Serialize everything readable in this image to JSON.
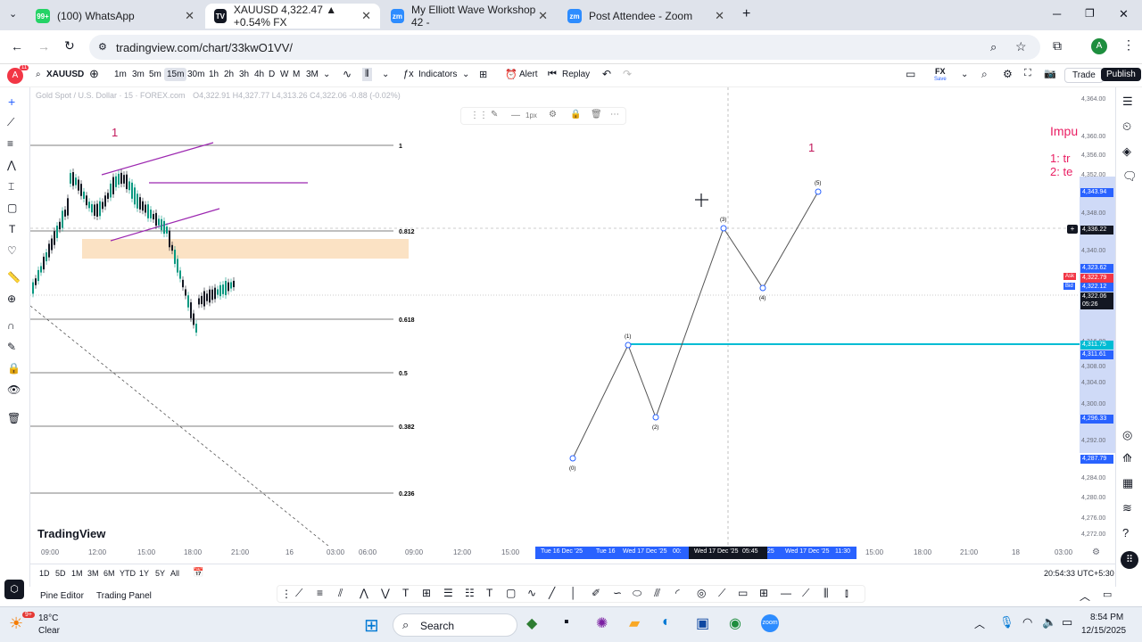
{
  "browser": {
    "tabs": [
      {
        "label": "(100) WhatsApp",
        "icon": "whatsapp-icon",
        "badge": "99+"
      },
      {
        "label": "XAUUSD 4,322.47 ▲ +0.54% FX",
        "icon": "tradingview-icon"
      },
      {
        "label": "My Elliott Wave Workshop 42 -",
        "icon": "zoom-icon"
      },
      {
        "label": "Post Attendee - Zoom",
        "icon": "zoom-icon"
      }
    ],
    "url": "tradingview.com/chart/33kwO1VV/",
    "profile_letter": "A"
  },
  "toolbar": {
    "avatar_letter": "A",
    "avatar_badge": "11",
    "symbol": "XAUUSD",
    "intervals": [
      "1m",
      "3m",
      "5m",
      "15m",
      "30m",
      "1h",
      "2h",
      "3h",
      "4h",
      "D",
      "W",
      "M",
      "3M"
    ],
    "indicators_label": "Indicators",
    "alert_label": "Alert",
    "replay_label": "Replay",
    "fx_label": "FX",
    "save_label": "Save",
    "trade_label": "Trade",
    "publish_label": "Publish"
  },
  "legend": {
    "title": "Gold Spot / U.S. Dollar · 15 · FOREX.com",
    "ohlc": "O4,322.91 H4,327.77 L4,313.26 C4,322.06 -0.88 (-0.02%)"
  },
  "drawing_toolbar": {
    "width_label": "1px"
  },
  "chart": {
    "left_label": "1",
    "right_label": "1",
    "fib_levels": [
      "1",
      "0.812",
      "0.618",
      "0.5",
      "0.382",
      "0.236"
    ],
    "waves": [
      {
        "label": "(0)",
        "price": 4287.79
      },
      {
        "label": "(1)",
        "price": 4311.75
      },
      {
        "label": "(2)",
        "price": 4296.33
      },
      {
        "label": "(3)",
        "price": 4336.22
      },
      {
        "label": "(4)",
        "price": 4323.62
      },
      {
        "label": "(5)",
        "price": 4343.94
      }
    ],
    "note_title": "Impu",
    "note_lines": [
      "1: tr",
      "2: te"
    ]
  },
  "price_scale": {
    "ticks": [
      "4,364.00",
      "4,360.00",
      "4,356.00",
      "4,352.00",
      "4,348.00",
      "4,340.00",
      "4,332.00",
      "4,316.00",
      "4,308.00",
      "4,304.00",
      "4,300.00",
      "4,292.00",
      "4,284.00",
      "4,280.00",
      "4,276.00",
      "4,272.00"
    ],
    "tags": [
      {
        "value": "4,343.94",
        "color": "#2962ff"
      },
      {
        "value": "4,336.22",
        "color": "#131722"
      },
      {
        "value": "4,323.62",
        "color": "#2962ff"
      },
      {
        "value": "4,322.79",
        "color": "#f23645",
        "side": "Ask"
      },
      {
        "value": "4,322.12",
        "color": "#2962ff",
        "side": "Bid"
      },
      {
        "value": "4,322.06",
        "color": "#131722"
      },
      {
        "value": "05:26",
        "color": "#131722"
      },
      {
        "value": "4,311.75",
        "color": "#00bcd4"
      },
      {
        "value": "4,311.61",
        "color": "#2962ff"
      },
      {
        "value": "4,296.33",
        "color": "#2962ff"
      },
      {
        "value": "4,287.79",
        "color": "#2962ff"
      }
    ]
  },
  "time_axis": {
    "ticks": [
      "09:00",
      "12:00",
      "15:00",
      "18:00",
      "21:00",
      "16",
      "03:00",
      "06:00",
      "09:00",
      "12:00",
      "15:00",
      "15:00",
      "18:00",
      "21:00",
      "18",
      "03:00"
    ],
    "highlight": [
      "Tue 16 Dec '25",
      "Tue 16",
      "Wed 17 Dec '25",
      "00:",
      "Wed 17 Dec '25",
      "05:45",
      "25",
      "Wed 17 Dec '25",
      "11:30"
    ]
  },
  "bottom": {
    "ranges": [
      "1D",
      "5D",
      "1M",
      "3M",
      "6M",
      "YTD",
      "1Y",
      "5Y",
      "All"
    ],
    "clock": "20:54:33 UTC+5:30",
    "panels": [
      "Pine Editor",
      "Trading Panel"
    ]
  },
  "branding": "TradingView",
  "taskbar": {
    "temp": "18°C",
    "weather": "Clear",
    "weather_badge": "9+",
    "search": "Search",
    "time": "8:54 PM",
    "date": "12/15/2025"
  }
}
